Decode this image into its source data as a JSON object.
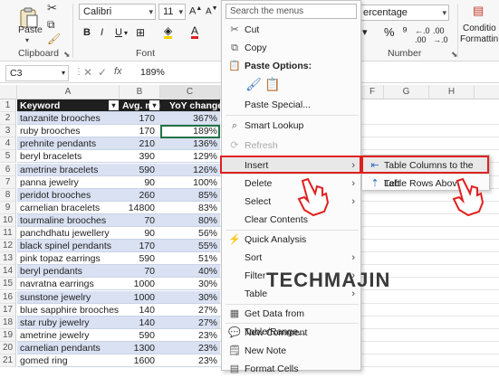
{
  "ribbon": {
    "paste_label": "Paste",
    "clipboard_label": "Clipboard",
    "font_label": "Font",
    "number_label": "Number",
    "font_name": "Calibri",
    "font_size": "11",
    "number_format": "ercentage",
    "conditional_label_1": "Conditio",
    "conditional_label_2": "Formattin"
  },
  "formula_bar": {
    "cell_ref": "C3",
    "fx": "fx",
    "value": "189%"
  },
  "columns": [
    "A",
    "B",
    "C",
    "D",
    "E",
    "F",
    "G",
    "H"
  ],
  "table": {
    "headers": [
      "Keyword",
      "Avg. mon",
      "YoY change"
    ],
    "rows": [
      {
        "n": "2",
        "kw": "tanzanite brooches",
        "avg": "170",
        "yoy": "367%"
      },
      {
        "n": "3",
        "kw": "ruby brooches",
        "avg": "170",
        "yoy": "189%"
      },
      {
        "n": "4",
        "kw": "prehnite pendants",
        "avg": "210",
        "yoy": "136%"
      },
      {
        "n": "5",
        "kw": "beryl bracelets",
        "avg": "390",
        "yoy": "129%"
      },
      {
        "n": "6",
        "kw": "ametrine bracelets",
        "avg": "590",
        "yoy": "126%"
      },
      {
        "n": "7",
        "kw": "panna jewelry",
        "avg": "90",
        "yoy": "100%"
      },
      {
        "n": "8",
        "kw": "peridot brooches",
        "avg": "260",
        "yoy": "85%"
      },
      {
        "n": "9",
        "kw": "carnelian bracelets",
        "avg": "14800",
        "yoy": "83%"
      },
      {
        "n": "10",
        "kw": "tourmaline brooches",
        "avg": "70",
        "yoy": "80%"
      },
      {
        "n": "11",
        "kw": "panchdhatu jewellery",
        "avg": "90",
        "yoy": "56%"
      },
      {
        "n": "12",
        "kw": "black spinel pendants",
        "avg": "170",
        "yoy": "55%"
      },
      {
        "n": "13",
        "kw": "pink topaz earrings",
        "avg": "590",
        "yoy": "51%"
      },
      {
        "n": "14",
        "kw": "beryl pendants",
        "avg": "70",
        "yoy": "40%"
      },
      {
        "n": "15",
        "kw": "navratna earrings",
        "avg": "1000",
        "yoy": "30%"
      },
      {
        "n": "16",
        "kw": "sunstone jewelry",
        "avg": "1000",
        "yoy": "30%"
      },
      {
        "n": "17",
        "kw": "blue sapphire brooches",
        "avg": "140",
        "yoy": "27%"
      },
      {
        "n": "18",
        "kw": "star ruby jewelry",
        "avg": "140",
        "yoy": "27%"
      },
      {
        "n": "19",
        "kw": "ametrine jewelry",
        "avg": "590",
        "yoy": "23%"
      },
      {
        "n": "20",
        "kw": "carnelian pendants",
        "avg": "1300",
        "yoy": "23%"
      },
      {
        "n": "21",
        "kw": "gomed ring",
        "avg": "1600",
        "yoy": "23%"
      }
    ]
  },
  "context_menu": {
    "search_placeholder": "Search the menus",
    "items": {
      "cut": "Cut",
      "copy": "Copy",
      "paste_options": "Paste Options:",
      "paste_special": "Paste Special...",
      "smart_lookup": "Smart Lookup",
      "refresh": "Refresh",
      "insert": "Insert",
      "delete": "Delete",
      "select": "Select",
      "clear_contents": "Clear Contents",
      "quick_analysis": "Quick Analysis",
      "sort": "Sort",
      "filter": "Filter",
      "table": "Table",
      "get_data": "Get Data from Table/Range...",
      "new_comment": "New Comment",
      "new_note": "New Note",
      "format_cells": "Format Cells"
    }
  },
  "submenu": {
    "columns_left": "Table Columns to the Left",
    "rows_above": "Table Rows Above"
  },
  "watermark": "TECHMAJIN",
  "colors": {
    "header_bg": "#1f1f1f",
    "band_bg": "#d9e1f2",
    "highlight_red": "#e02020",
    "selected_cell": "#217346"
  }
}
